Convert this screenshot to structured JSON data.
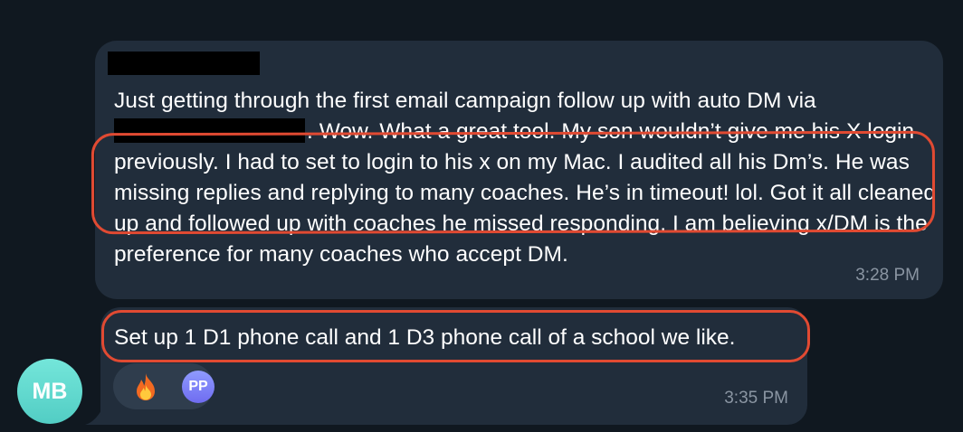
{
  "messages": [
    {
      "text_before": "Just getting through the first email campaign follow up with auto DM via ",
      "text_after": ". Wow. What a great tool.  My son wouldn’t give me his X login previously. I had to set to login to his x on my Mac. I audited all his Dm’s. He was missing replies and replying to many coaches.  He’s in timeout! lol.  Got it all cleaned up and followed up with coaches he missed responding.  I am believing x/DM is the preference for many coaches who accept DM.",
      "time": "3:28 PM"
    },
    {
      "text": "Set up 1 D1 phone call and 1 D3 phone call of a school we like.",
      "time": "3:35 PM",
      "reactions": [
        {
          "icon": "fire-icon",
          "emoji": "🔥"
        },
        {
          "initials": "PP",
          "color": "#7b7df5"
        }
      ]
    }
  ],
  "sender": {
    "initials": "MB",
    "avatar_color": "#5fd6cc"
  },
  "colors": {
    "background": "#101820",
    "bubble": "#212d3b",
    "highlight": "#e14a32",
    "time_text": "#8a95a2"
  }
}
